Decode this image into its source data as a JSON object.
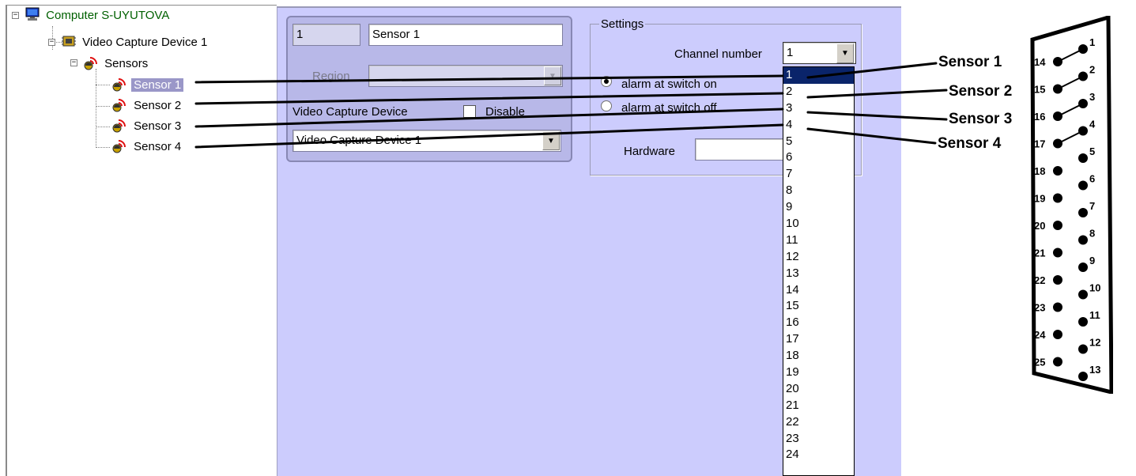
{
  "tree": {
    "computer": "Computer S-UYUTOVA",
    "device": "Video Capture Device 1",
    "sensors_group": "Sensors",
    "sensors": [
      "Sensor 1",
      "Sensor 2",
      "Sensor 3",
      "Sensor 4"
    ],
    "selected_index": 0
  },
  "form": {
    "id_value": "1",
    "name_value": "Sensor 1",
    "region_label": "Region",
    "region_value": "",
    "video_device_label": "Video Capture Device",
    "disable_label": "Disable",
    "video_device_value": "Video Capture Device 1"
  },
  "settings": {
    "title": "Settings",
    "channel_label": "Channel number",
    "channel_value": "1",
    "radio_on": "alarm at switch on",
    "radio_off": "alarm at switch off",
    "hardware_label": "Hardware",
    "hardware_value": ""
  },
  "channel_options": [
    "1",
    "2",
    "3",
    "4",
    "5",
    "6",
    "7",
    "8",
    "9",
    "10",
    "11",
    "12",
    "13",
    "14",
    "15",
    "16",
    "17",
    "18",
    "19",
    "20",
    "21",
    "22",
    "23",
    "24"
  ],
  "callouts": {
    "sensor_labels": [
      "Sensor 1",
      "Sensor 2",
      "Sensor 3",
      "Sensor 4"
    ]
  },
  "connector": {
    "top_row": [
      "1",
      "2",
      "3",
      "4",
      "5",
      "6",
      "7",
      "8",
      "9",
      "10",
      "11",
      "12",
      "13"
    ],
    "bottom_row": [
      "14",
      "15",
      "16",
      "17",
      "18",
      "19",
      "20",
      "21",
      "22",
      "23",
      "24",
      "25"
    ]
  },
  "colors": {
    "panel_bg": "#ccccfd",
    "selection": "#0a246a",
    "tree_text_computer": "#006000"
  }
}
